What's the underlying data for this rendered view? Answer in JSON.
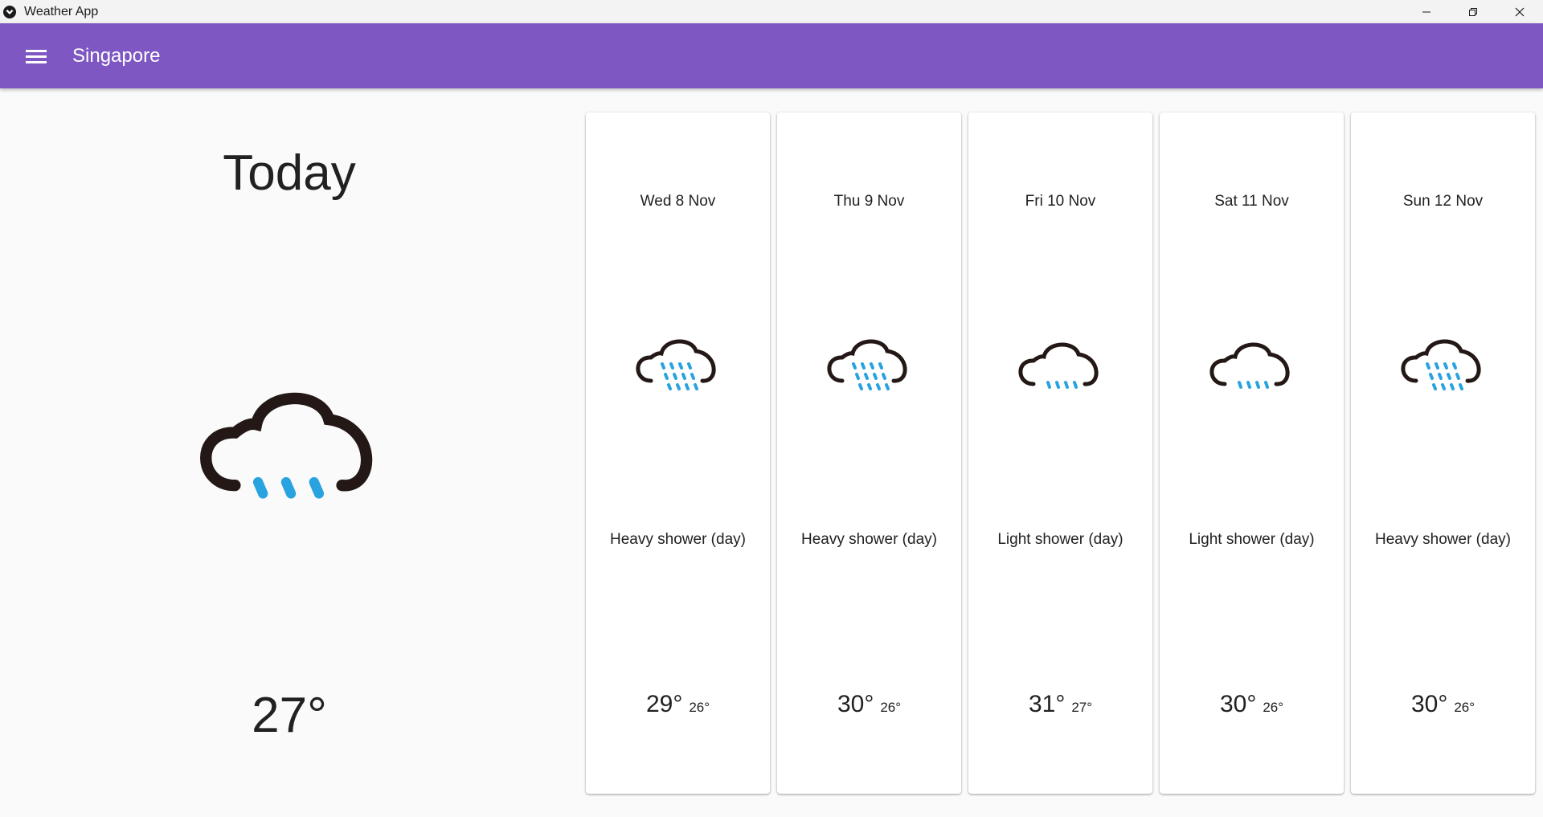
{
  "window": {
    "title": "Weather App",
    "controls": [
      "minimize-icon",
      "restore-icon",
      "close-icon"
    ]
  },
  "appbar": {
    "menu_icon": "menu-icon",
    "city": "Singapore",
    "color": "#7e57c2"
  },
  "today": {
    "label": "Today",
    "icon": "light-rain-cloud-icon",
    "temperature": "27°"
  },
  "forecast": [
    {
      "date": "Wed 8 Nov",
      "icon": "heavy-rain-cloud-icon",
      "condition": "Heavy shower (day)",
      "high": "29°",
      "low": "26°"
    },
    {
      "date": "Thu 9 Nov",
      "icon": "heavy-rain-cloud-icon",
      "condition": "Heavy shower (day)",
      "high": "30°",
      "low": "26°"
    },
    {
      "date": "Fri 10 Nov",
      "icon": "light-rain-cloud-icon",
      "condition": "Light shower (day)",
      "high": "31°",
      "low": "27°"
    },
    {
      "date": "Sat 11 Nov",
      "icon": "light-rain-cloud-icon",
      "condition": "Light shower (day)",
      "high": "30°",
      "low": "26°"
    },
    {
      "date": "Sun 12 Nov",
      "icon": "heavy-rain-cloud-icon",
      "condition": "Heavy shower (day)",
      "high": "30°",
      "low": "26°"
    }
  ],
  "colors": {
    "cloud": "#231816",
    "rain": "#29a3e0"
  }
}
